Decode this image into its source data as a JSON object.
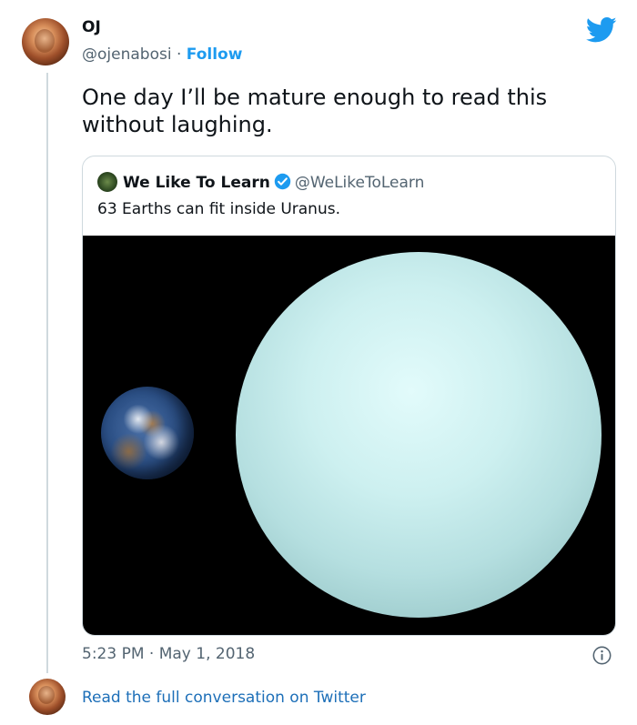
{
  "author": {
    "display_name": "OJ",
    "handle": "@ojenabosi",
    "separator": "·",
    "follow_label": "Follow"
  },
  "tweet": {
    "text": "One day I’ll be mature enough to read this without laughing."
  },
  "quoted_tweet": {
    "display_name": "We Like To Learn",
    "handle": "@WeLikeToLearn",
    "text": "63 Earths can fit inside Uranus.",
    "verified": true
  },
  "meta": {
    "timestamp": "5:23 PM · May 1, 2018"
  },
  "footer": {
    "read_more_label": "Read the full conversation on Twitter"
  },
  "icons": {
    "brand": "twitter-bird-icon",
    "verified": "verified-badge-icon",
    "info": "info-icon"
  },
  "colors": {
    "brand_blue": "#1d9bf0",
    "link_blue": "#1d6fb8",
    "secondary_text": "#536471",
    "border": "#cfd9de"
  }
}
